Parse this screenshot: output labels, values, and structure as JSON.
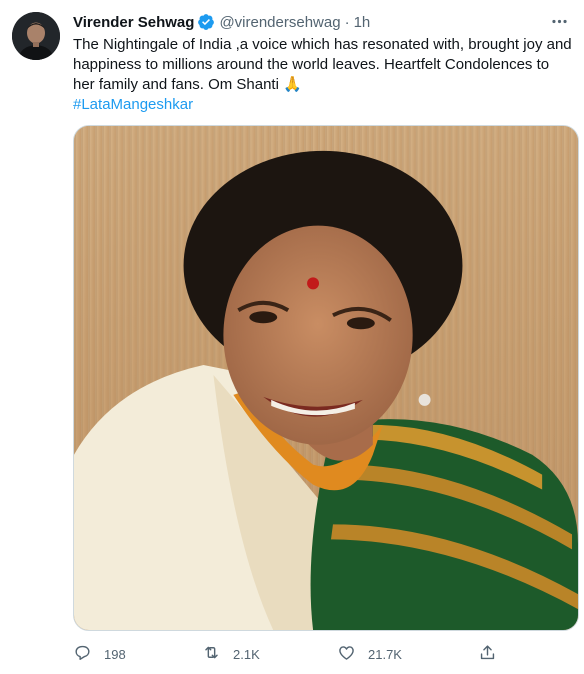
{
  "tweet": {
    "author": {
      "display_name": "Virender Sehwag",
      "handle": "@virendersehwag",
      "verified": true
    },
    "separator": "·",
    "time": "1h",
    "text_lines": [
      "The Nightingale of India ,a voice which has resonated with, brought joy and",
      "happiness to millions around the world leaves. Heartfelt Condolences to",
      "her family and fans. Om Shanti 🙏"
    ],
    "hashtag": "#LataMangeshkar",
    "actions": {
      "replies": "198",
      "retweets": "2.1K",
      "likes": "21.7K"
    }
  },
  "colors": {
    "accent": "#1d9bf0",
    "secondary_text": "#536471",
    "primary_text": "#0f1419",
    "border": "#cfd9de"
  },
  "icons": [
    "more-icon",
    "verified-icon",
    "reply-icon",
    "retweet-icon",
    "like-icon",
    "share-icon"
  ]
}
